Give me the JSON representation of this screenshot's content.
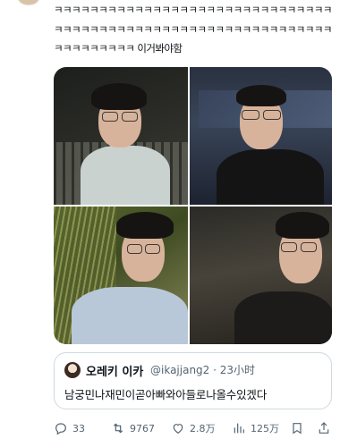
{
  "tweet": {
    "text": "ㅋㅋㅋㅋㅋㅋㅋㅋㅋㅋㅋㅋㅋㅋㅋㅋㅋㅋㅋㅋㅋㅋㅋㅋㅋㅋㅋㅋㅋㅋㅋㅋㅋㅋㅋㅋㅋㅋㅋㅋㅋㅋㅋㅋㅋㅋㅋㅋㅋㅋㅋㅋㅋㅋㅋㅋㅋㅋㅋㅋㅋㅋㅋㅋㅋㅋㅋㅋㅋㅋㅋ 이거봐야함"
  },
  "quote": {
    "name": "오레키 이카",
    "handle": "@ikajjang2 · 23小时",
    "text": "남궁민나재민이곧아빠와아들로나올수있겠다"
  },
  "actions": {
    "replies": "33",
    "retweets": "9767",
    "likes": "2.8万",
    "views": "125万"
  },
  "icons": [
    "reply-icon",
    "retweet-icon",
    "like-icon",
    "views-icon",
    "bookmark-icon",
    "share-icon"
  ]
}
